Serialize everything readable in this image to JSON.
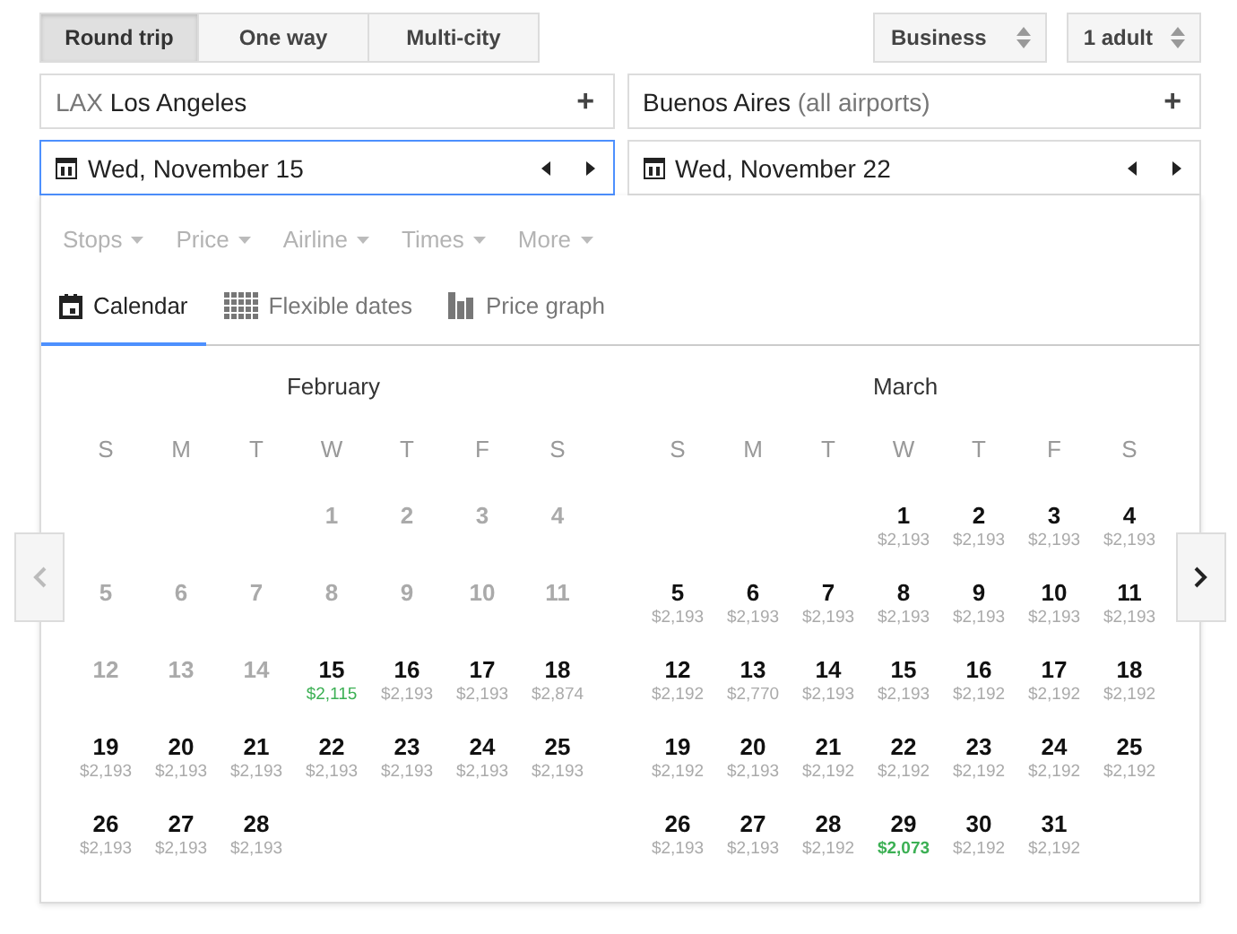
{
  "trip_types": [
    {
      "label": "Round trip",
      "selected": true
    },
    {
      "label": "One way",
      "selected": false
    },
    {
      "label": "Multi-city",
      "selected": false
    }
  ],
  "cabin": {
    "value": "Business"
  },
  "passengers": {
    "value": "1 adult"
  },
  "origin": {
    "code": "LAX",
    "city": "Los Angeles",
    "add": "+"
  },
  "destination": {
    "city": "Buenos Aires",
    "note": "(all airports)",
    "add": "+"
  },
  "departure_date": {
    "value": "Wed, November 15",
    "focused": true
  },
  "return_date": {
    "value": "Wed, November 22",
    "focused": false
  },
  "filters": [
    "Stops",
    "Price",
    "Airline",
    "Times",
    "More"
  ],
  "views": [
    {
      "label": "Calendar",
      "kind": "calendar",
      "selected": true
    },
    {
      "label": "Flexible dates",
      "kind": "grid",
      "selected": false
    },
    {
      "label": "Price graph",
      "kind": "bars",
      "selected": false
    }
  ],
  "prev_button": {
    "disabled": true
  },
  "next_button": {
    "disabled": false
  },
  "months": [
    {
      "name": "February",
      "weekdays": [
        "S",
        "M",
        "T",
        "W",
        "T",
        "F",
        "S"
      ],
      "days": [
        {
          "kind": "blank"
        },
        {
          "kind": "blank"
        },
        {
          "kind": "blank"
        },
        {
          "day": "1",
          "kind": "past"
        },
        {
          "day": "2",
          "kind": "past"
        },
        {
          "day": "3",
          "kind": "past"
        },
        {
          "day": "4",
          "kind": "past"
        },
        {
          "day": "5",
          "kind": "past"
        },
        {
          "day": "6",
          "kind": "past"
        },
        {
          "day": "7",
          "kind": "past"
        },
        {
          "day": "8",
          "kind": "past"
        },
        {
          "day": "9",
          "kind": "past"
        },
        {
          "day": "10",
          "kind": "past"
        },
        {
          "day": "11",
          "kind": "past"
        },
        {
          "day": "12",
          "kind": "past"
        },
        {
          "day": "13",
          "kind": "past"
        },
        {
          "day": "14",
          "kind": "past"
        },
        {
          "day": "15",
          "price": "$2,115",
          "kind": "low"
        },
        {
          "day": "16",
          "price": "$2,193",
          "kind": "fare"
        },
        {
          "day": "17",
          "price": "$2,193",
          "kind": "fare"
        },
        {
          "day": "18",
          "price": "$2,874",
          "kind": "fare"
        },
        {
          "day": "19",
          "price": "$2,193",
          "kind": "fare"
        },
        {
          "day": "20",
          "price": "$2,193",
          "kind": "fare"
        },
        {
          "day": "21",
          "price": "$2,193",
          "kind": "fare"
        },
        {
          "day": "22",
          "price": "$2,193",
          "kind": "fare"
        },
        {
          "day": "23",
          "price": "$2,193",
          "kind": "fare"
        },
        {
          "day": "24",
          "price": "$2,193",
          "kind": "fare"
        },
        {
          "day": "25",
          "price": "$2,193",
          "kind": "fare"
        },
        {
          "day": "26",
          "price": "$2,193",
          "kind": "fare"
        },
        {
          "day": "27",
          "price": "$2,193",
          "kind": "fare"
        },
        {
          "day": "28",
          "price": "$2,193",
          "kind": "fare"
        }
      ]
    },
    {
      "name": "March",
      "weekdays": [
        "S",
        "M",
        "T",
        "W",
        "T",
        "F",
        "S"
      ],
      "days": [
        {
          "kind": "blank"
        },
        {
          "kind": "blank"
        },
        {
          "kind": "blank"
        },
        {
          "day": "1",
          "price": "$2,193",
          "kind": "fare"
        },
        {
          "day": "2",
          "price": "$2,193",
          "kind": "fare"
        },
        {
          "day": "3",
          "price": "$2,193",
          "kind": "fare"
        },
        {
          "day": "4",
          "price": "$2,193",
          "kind": "fare"
        },
        {
          "day": "5",
          "price": "$2,193",
          "kind": "fare"
        },
        {
          "day": "6",
          "price": "$2,193",
          "kind": "fare"
        },
        {
          "day": "7",
          "price": "$2,193",
          "kind": "fare"
        },
        {
          "day": "8",
          "price": "$2,193",
          "kind": "fare"
        },
        {
          "day": "9",
          "price": "$2,193",
          "kind": "fare"
        },
        {
          "day": "10",
          "price": "$2,193",
          "kind": "fare"
        },
        {
          "day": "11",
          "price": "$2,193",
          "kind": "fare"
        },
        {
          "day": "12",
          "price": "$2,192",
          "kind": "fare"
        },
        {
          "day": "13",
          "price": "$2,770",
          "kind": "fare"
        },
        {
          "day": "14",
          "price": "$2,193",
          "kind": "fare"
        },
        {
          "day": "15",
          "price": "$2,193",
          "kind": "fare"
        },
        {
          "day": "16",
          "price": "$2,192",
          "kind": "fare"
        },
        {
          "day": "17",
          "price": "$2,192",
          "kind": "fare"
        },
        {
          "day": "18",
          "price": "$2,192",
          "kind": "fare"
        },
        {
          "day": "19",
          "price": "$2,192",
          "kind": "fare"
        },
        {
          "day": "20",
          "price": "$2,193",
          "kind": "fare"
        },
        {
          "day": "21",
          "price": "$2,192",
          "kind": "fare"
        },
        {
          "day": "22",
          "price": "$2,192",
          "kind": "fare"
        },
        {
          "day": "23",
          "price": "$2,192",
          "kind": "fare"
        },
        {
          "day": "24",
          "price": "$2,192",
          "kind": "fare"
        },
        {
          "day": "25",
          "price": "$2,192",
          "kind": "fare"
        },
        {
          "day": "26",
          "price": "$2,193",
          "kind": "fare"
        },
        {
          "day": "27",
          "price": "$2,193",
          "kind": "fare"
        },
        {
          "day": "28",
          "price": "$2,192",
          "kind": "fare"
        },
        {
          "day": "29",
          "price": "$2,073",
          "kind": "lowest"
        },
        {
          "day": "30",
          "price": "$2,192",
          "kind": "fare"
        },
        {
          "day": "31",
          "price": "$2,192",
          "kind": "fare"
        }
      ]
    }
  ]
}
